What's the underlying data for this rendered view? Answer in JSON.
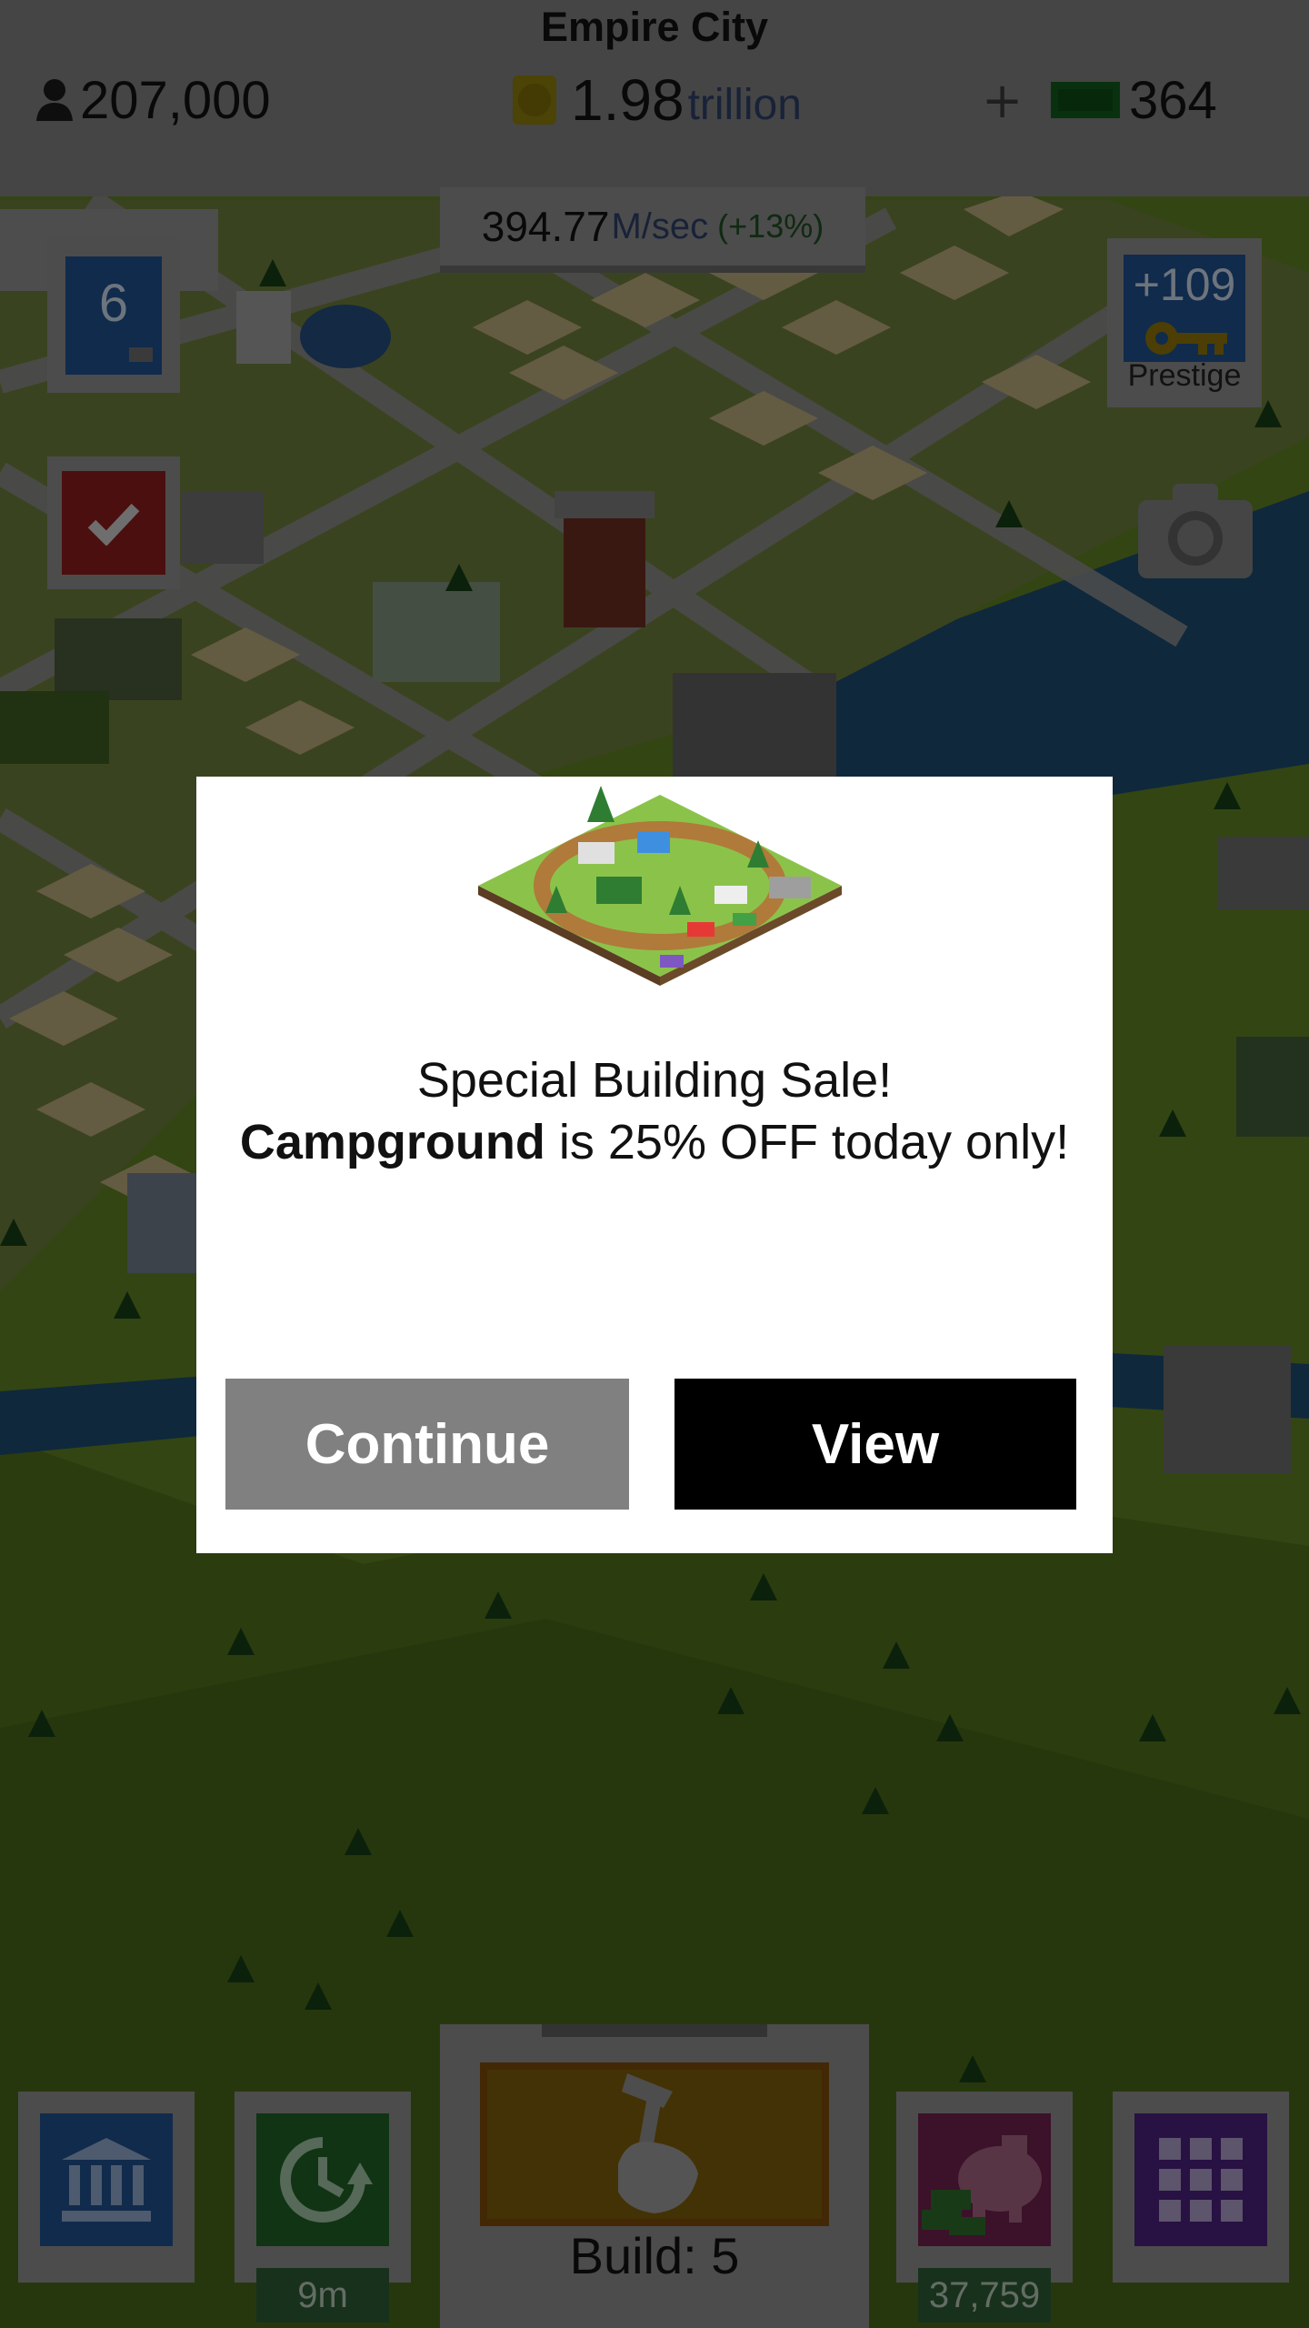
{
  "hud": {
    "city_name": "Empire City",
    "population": "207,000",
    "coins_value": "1.98",
    "coins_unit": "trillion",
    "cash_plus": "+",
    "cash_value": "364",
    "rate_value": "394.77",
    "rate_unit": "M/sec",
    "rate_bonus": "(+13%)"
  },
  "side": {
    "level": "6",
    "level_progress": 0.7,
    "prestige_value": "+109",
    "prestige_label": "Prestige"
  },
  "bottom": {
    "timer_label": "9m",
    "bank_value": "37,759",
    "build_label": "Build: 5",
    "build_progress": 0.0
  },
  "modal": {
    "line1": "Special Building Sale!",
    "building_name": "Campground",
    "line2_rest": " is 25% OFF today only!",
    "continue_label": "Continue",
    "view_label": "View"
  },
  "colors": {
    "overlay": "rgba(0,0,0,0.45)",
    "modal_bg": "#ffffff",
    "continue_bg": "#808080",
    "view_bg": "#000000"
  }
}
